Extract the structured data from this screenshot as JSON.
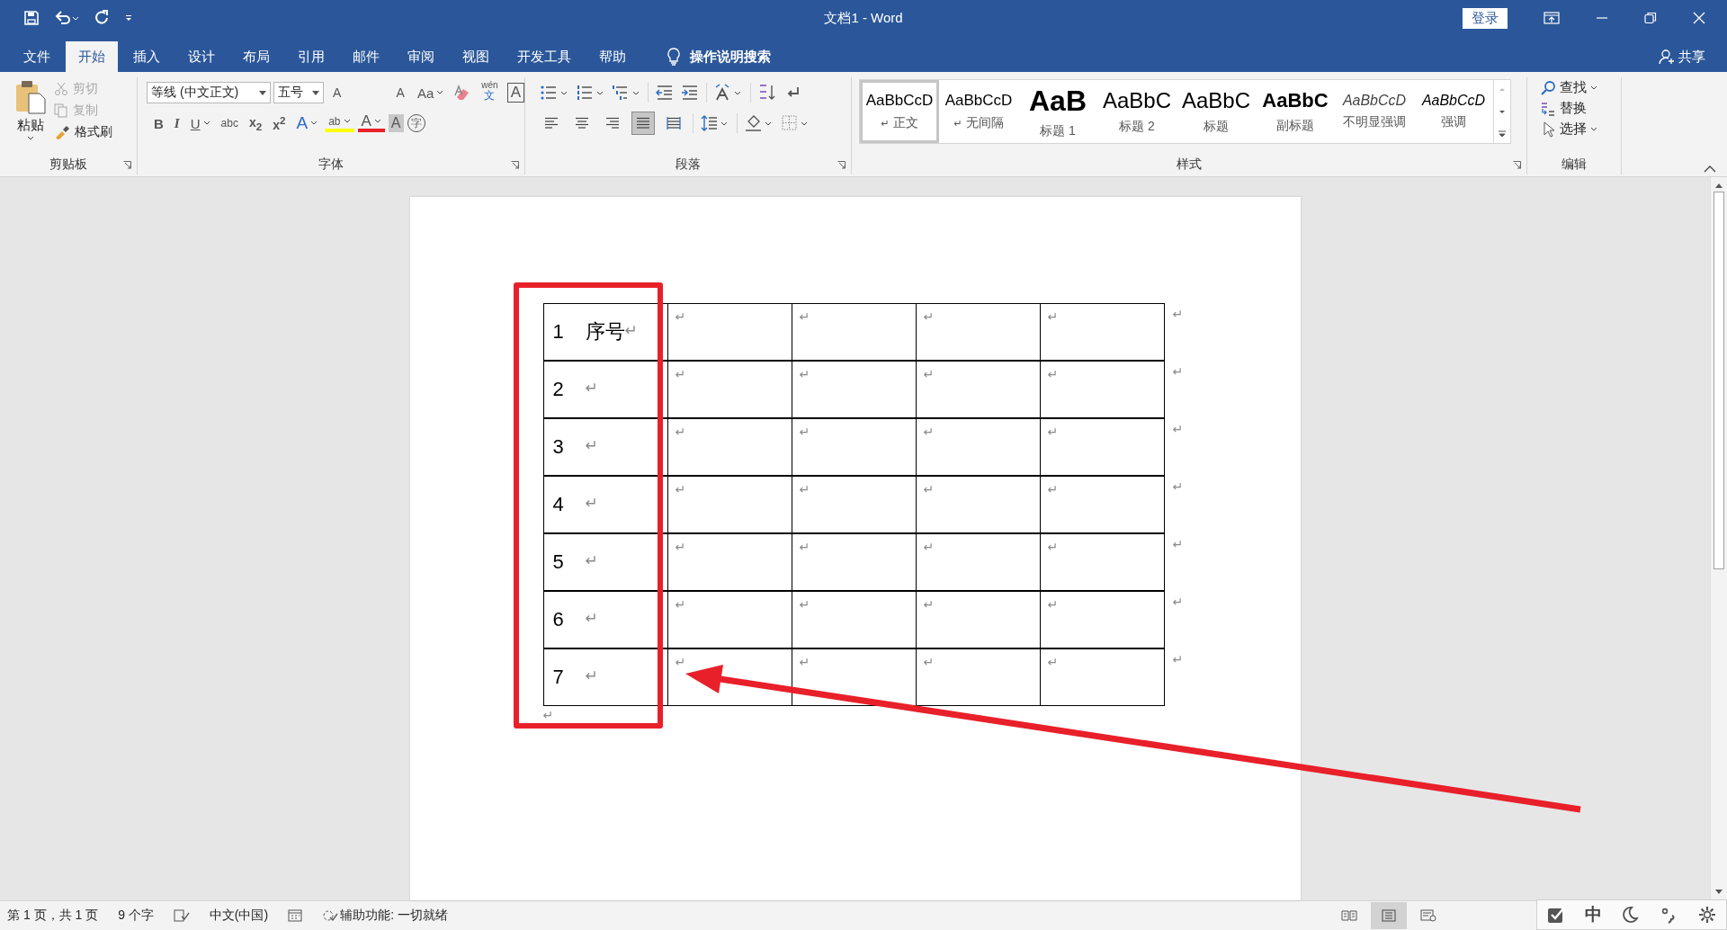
{
  "window": {
    "title": "文档1 - Word",
    "sign_in": "登录"
  },
  "tabs": [
    {
      "label": "文件",
      "selected": false
    },
    {
      "label": "开始",
      "selected": true
    },
    {
      "label": "插入",
      "selected": false
    },
    {
      "label": "设计",
      "selected": false
    },
    {
      "label": "布局",
      "selected": false
    },
    {
      "label": "引用",
      "selected": false
    },
    {
      "label": "邮件",
      "selected": false
    },
    {
      "label": "审阅",
      "selected": false
    },
    {
      "label": "视图",
      "selected": false
    },
    {
      "label": "开发工具",
      "selected": false
    },
    {
      "label": "帮助",
      "selected": false
    }
  ],
  "tell_me": "操作说明搜索",
  "share": "共享",
  "ribbon": {
    "clipboard": {
      "label": "剪贴板",
      "paste": "粘贴",
      "items": [
        {
          "kind": "cut",
          "label": "剪切",
          "disabled": true
        },
        {
          "kind": "copy",
          "label": "复制",
          "disabled": true
        },
        {
          "kind": "painter",
          "label": "格式刷",
          "disabled": false
        }
      ]
    },
    "font": {
      "label": "字体",
      "name": "等线 (中文正文)",
      "size": "五号",
      "row1": [
        {
          "kind": "grow",
          "label": "A"
        },
        {
          "kind": "shrink",
          "label": "A"
        },
        {
          "kind": "case",
          "label": "Aa"
        },
        {
          "kind": "clear"
        },
        {
          "kind": "phonetic",
          "label": "wén",
          "sub": "文"
        },
        {
          "kind": "border",
          "label": "A"
        }
      ],
      "row2": [
        {
          "kind": "bold",
          "label": "B"
        },
        {
          "kind": "italic",
          "label": "I"
        },
        {
          "kind": "underline",
          "label": "U"
        },
        {
          "kind": "strike",
          "label": "abc"
        },
        {
          "kind": "sub",
          "label": "x$_{2}$"
        },
        {
          "kind": "sup",
          "label": "x$^{2}$"
        },
        {
          "kind": "effects",
          "label": "A"
        },
        {
          "kind": "highlight",
          "label": "ab"
        },
        {
          "kind": "color",
          "label": "A"
        },
        {
          "kind": "shading",
          "label": "A"
        },
        {
          "kind": "enclose",
          "label": "字"
        }
      ]
    },
    "paragraph": {
      "label": "段落",
      "alignments": [
        {
          "kind": "left",
          "selected": false
        },
        {
          "kind": "center",
          "selected": false
        },
        {
          "kind": "right",
          "selected": false
        },
        {
          "kind": "justify",
          "selected": true
        },
        {
          "kind": "distributed",
          "selected": false
        }
      ]
    },
    "styles": {
      "label": "样式",
      "items": [
        {
          "kind": "normal",
          "preview": "AaBbCcD",
          "name": "正文",
          "mark": "↵",
          "selected": true
        },
        {
          "kind": "normal",
          "preview": "AaBbCcD",
          "name": "无间隔",
          "mark": "↵",
          "selected": false
        },
        {
          "kind": "heading1",
          "preview": "AaB",
          "name": "标题 1",
          "selected": false
        },
        {
          "kind": "heading2",
          "preview": "AaBbC",
          "name": "标题 2",
          "selected": false
        },
        {
          "kind": "title",
          "preview": "AaBbC",
          "name": "标题",
          "selected": false
        },
        {
          "kind": "subtitle",
          "preview": "AaBbC",
          "name": "副标题",
          "selected": false
        },
        {
          "kind": "subtle",
          "preview": "AaBbCcD",
          "name": "不明显强调",
          "selected": false
        },
        {
          "kind": "emphasis",
          "preview": "AaBbCcD",
          "name": "强调",
          "selected": false
        }
      ]
    },
    "editing": {
      "label": "编辑",
      "items": [
        {
          "kind": "find",
          "label": "查找"
        },
        {
          "kind": "replace",
          "label": "替换"
        },
        {
          "kind": "select",
          "label": "选择"
        }
      ]
    }
  },
  "document": {
    "rows": [
      {
        "number": "1",
        "cells": [
          {
            "text": "序号",
            "mark": "↵"
          },
          {
            "mark": "↵"
          },
          {
            "mark": "↵"
          },
          {
            "mark": "↵"
          },
          {
            "mark": "↵"
          }
        ],
        "end_mark": "↵"
      },
      {
        "number": "2",
        "cells": [
          {
            "mark": "↵"
          },
          {
            "mark": "↵"
          },
          {
            "mark": "↵"
          },
          {
            "mark": "↵"
          },
          {
            "mark": "↵"
          }
        ],
        "end_mark": "↵"
      },
      {
        "number": "3",
        "cells": [
          {
            "mark": "↵"
          },
          {
            "mark": "↵"
          },
          {
            "mark": "↵"
          },
          {
            "mark": "↵"
          },
          {
            "mark": "↵"
          }
        ],
        "end_mark": "↵"
      },
      {
        "number": "4",
        "cells": [
          {
            "mark": "↵"
          },
          {
            "mark": "↵"
          },
          {
            "mark": "↵"
          },
          {
            "mark": "↵"
          },
          {
            "mark": "↵"
          }
        ],
        "end_mark": "↵"
      },
      {
        "number": "5",
        "cells": [
          {
            "mark": "↵"
          },
          {
            "mark": "↵"
          },
          {
            "mark": "↵"
          },
          {
            "mark": "↵"
          },
          {
            "mark": "↵"
          }
        ],
        "end_mark": "↵"
      },
      {
        "number": "6",
        "cells": [
          {
            "mark": "↵"
          },
          {
            "mark": "↵"
          },
          {
            "mark": "↵"
          },
          {
            "mark": "↵"
          },
          {
            "mark": "↵"
          }
        ],
        "end_mark": "↵"
      },
      {
        "number": "7",
        "cells": [
          {
            "mark": "↵"
          },
          {
            "mark": "↵"
          },
          {
            "mark": "↵"
          },
          {
            "mark": "↵"
          },
          {
            "mark": "↵"
          }
        ],
        "end_mark": "↵"
      }
    ],
    "after_table_mark": "↵"
  },
  "status_bar": {
    "page": "第 1 页，共 1 页",
    "words": "9 个字",
    "language": "中文(中国)",
    "accessibility": "辅助功能: 一切就绪",
    "views": [
      {
        "kind": "read",
        "selected": false
      },
      {
        "kind": "print",
        "selected": true
      },
      {
        "kind": "web",
        "selected": false
      }
    ]
  },
  "ime_toolbar": {
    "mode": "中"
  }
}
